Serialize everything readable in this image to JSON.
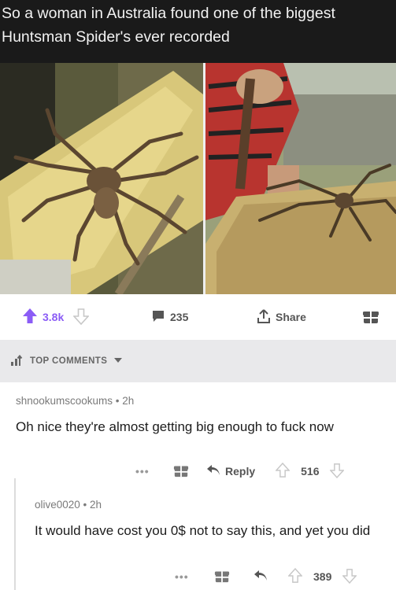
{
  "header": {
    "line1": "So a woman in Australia found one of the biggest",
    "line2": "Huntsman Spider's ever recorded"
  },
  "actions": {
    "upvotes": "3.8k",
    "comments": "235",
    "share_label": "Share"
  },
  "section": {
    "label": "TOP COMMENTS"
  },
  "comments": [
    {
      "meta": "shnookumscookums • 2h",
      "text": "Oh nice they're almost getting big enough to fuck now",
      "reply_label": "Reply",
      "score": "516"
    },
    {
      "meta": "olive0020 • 2h",
      "text": "It would have cost you 0$ not to say this, and yet you did",
      "score": "389"
    }
  ],
  "icons": {
    "upvote": "upvote-arrow-icon",
    "downvote": "downvote-arrow-icon",
    "comment": "comment-bubble-icon",
    "share": "share-icon",
    "award": "gift-award-icon",
    "more": "more-dots-icon",
    "reply": "reply-arrow-icon",
    "sort": "sort-chevron-icon"
  },
  "colors": {
    "upvote_active": "#8b5cf6",
    "header_bg": "#1a1a1a",
    "section_bg": "#e9e9eb"
  }
}
